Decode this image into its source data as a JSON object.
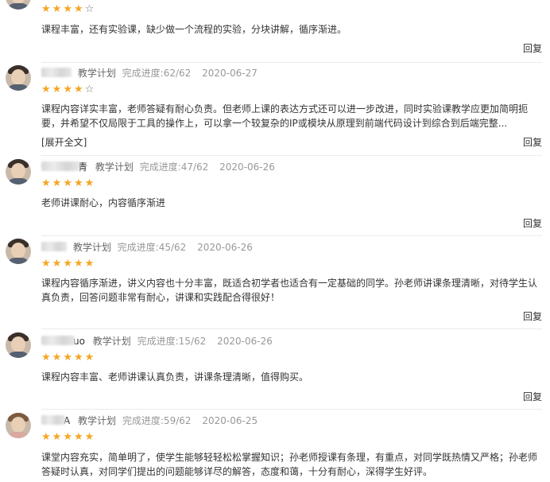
{
  "reply_label": "回复",
  "expand_label": "[展开全文]",
  "star_full": "★",
  "star_empty": "☆",
  "colors": {
    "star": "#f5a623",
    "meta": "#999999",
    "text": "#333333"
  },
  "reviews": [
    {
      "rating": 4,
      "text": "课程丰富，还有实验课，缺少做一个流程的实验，分块讲解，循序渐进。"
    },
    {
      "name_tail": "",
      "plan": "教学计划",
      "progress": "完成进度:62/62",
      "date": "2020-06-27",
      "rating": 4,
      "text": "课程内容详实丰富，老师答疑有耐心负责。但老师上课的表达方式还可以进一步改进，同时实验课教学应更加简明扼要，并希望不仅局限于工具的操作上，可以拿一个较复杂的IP或模块从原理到前端代码设计到综合到后端完整..."
    },
    {
      "name_tail": "青",
      "plan": "教学计划",
      "progress": "完成进度:47/62",
      "date": "2020-06-26",
      "rating": 5,
      "text": "老师讲课耐心，内容循序渐进"
    },
    {
      "name_tail": "",
      "plan": "教学计划",
      "progress": "完成进度:45/62",
      "date": "2020-06-26",
      "rating": 5,
      "text": "课程内容循序渐进，讲义内容也十分丰富，既适合初学者也适合有一定基础的同学。孙老师讲课条理清晰，对待学生认真负责，回答问题非常有耐心，讲课和实践配合得很好！"
    },
    {
      "name_tail": "uo",
      "plan": "教学计划",
      "progress": "完成进度:15/62",
      "date": "2020-06-26",
      "rating": 5,
      "text": "课程内容丰富、老师讲课认真负责，讲课条理清晰，值得购买。"
    },
    {
      "name_tail": "A",
      "plan": "教学计划",
      "progress": "完成进度:59/62",
      "date": "2020-06-25",
      "rating": 5,
      "text": "课堂内容充实，简单明了，使学生能够轻轻松松掌握知识；孙老师授课有条理，有重点，对同学既热情又严格；孙老师答疑时认真，对同学们提出的问题能够详尽的解答，态度和蔼，十分有耐心，深得学生好评。"
    }
  ]
}
